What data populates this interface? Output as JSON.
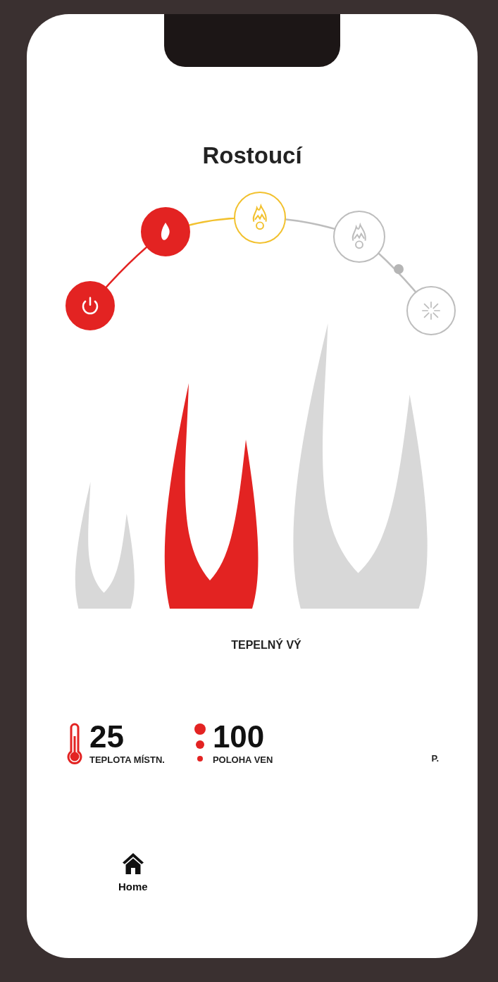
{
  "title": "Rostoucí",
  "steps": [
    {
      "done": true,
      "selected": false
    },
    {
      "done": true,
      "selected": false
    },
    {
      "done": false,
      "selected": true
    },
    {
      "done": false,
      "selected": false
    },
    {
      "done": false,
      "selected": false
    }
  ],
  "flames": [
    {
      "selected": false
    },
    {
      "selected": true
    },
    {
      "selected": false
    }
  ],
  "output_label": "TEPELNÝ VÝ",
  "stats": [
    {
      "kind": "temperature",
      "value": "25",
      "label": "TEPLOTA MÍSTN."
    },
    {
      "kind": "position",
      "value": "100",
      "label": "POLOHA VEN"
    },
    {
      "kind": "covered",
      "label": "P."
    }
  ],
  "nav": [
    {
      "label": "Home",
      "selected": true
    }
  ]
}
